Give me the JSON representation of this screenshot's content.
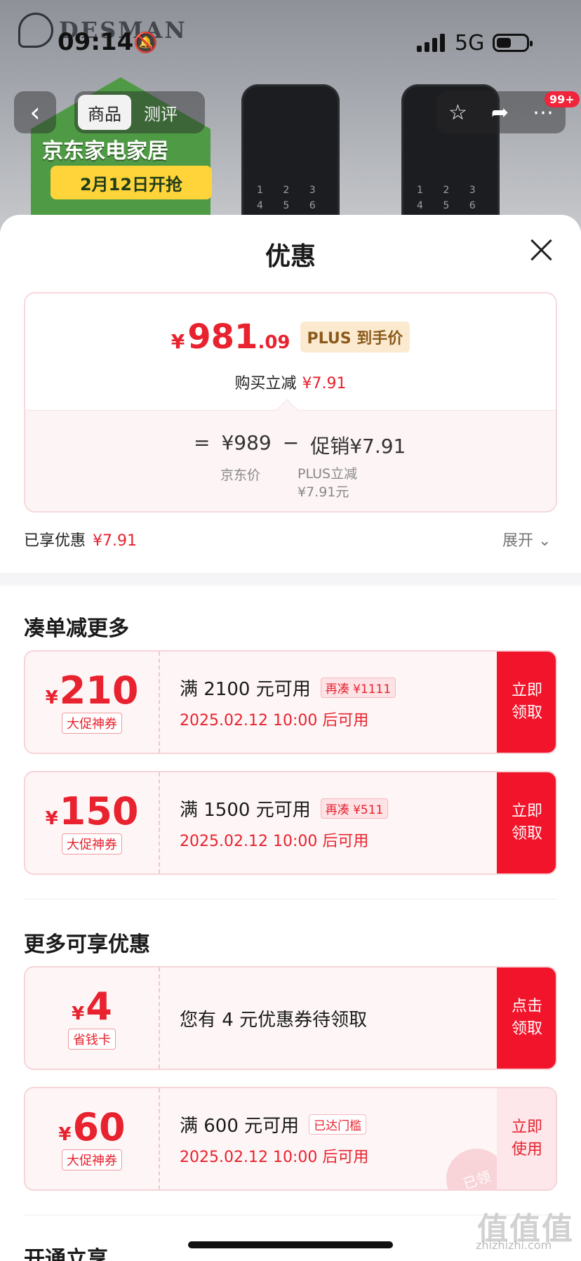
{
  "status_bar": {
    "time": "09:14",
    "network": "5G"
  },
  "background": {
    "brand": "DESMAN",
    "nav_tabs": [
      "商品",
      "测评"
    ],
    "cart_badge": "99+",
    "banner_title": "京东家电家居",
    "banner_date": "2月12日开抢"
  },
  "sheet": {
    "title": "优惠",
    "price": {
      "currency": "¥",
      "integer": "981",
      "decimal": ".09",
      "tag": "PLUS 到手价",
      "instant_label": "购买立减",
      "instant_value": "¥7.91",
      "eq": "=",
      "jd_price": "¥989",
      "minus": "−",
      "promo": "促销¥7.91",
      "jd_price_label": "京东价",
      "plus_label_1": "PLUS立减",
      "plus_label_2": "¥7.91元"
    },
    "enjoyed_label": "已享优惠",
    "enjoyed_value": "¥7.91",
    "expand_label": "展开",
    "section1_title": "凑单减更多",
    "section2_title": "更多可享优惠",
    "section3_title": "开通立享",
    "coupons": [
      {
        "currency": "¥",
        "amount": "210",
        "type": "大促神券",
        "line1": "满 2100 元可用",
        "tag": "再凑 ¥1111",
        "line2": "2025.02.12 10:00 后可用",
        "button": "立即领取"
      },
      {
        "currency": "¥",
        "amount": "150",
        "type": "大促神券",
        "line1": "满 1500 元可用",
        "tag": "再凑 ¥511",
        "line2": "2025.02.12 10:00 后可用",
        "button": "立即领取"
      },
      {
        "currency": "¥",
        "amount": "4",
        "type": "省钱卡",
        "line1": "您有 4 元优惠券待领取",
        "button": "点击领取"
      },
      {
        "currency": "¥",
        "amount": "60",
        "type": "大促神券",
        "line1": "满 600 元可用",
        "tag": "已达门槛",
        "line2": "2025.02.12 10:00 后可用",
        "button": "立即使用",
        "stamp": "已领"
      }
    ]
  },
  "watermark": {
    "main": "值值值",
    "sub": "zhizhizhi.com"
  },
  "colors": {
    "accent_red": "#e8222e",
    "button_red": "#f2142b",
    "plus_gold": "#8b5a1a"
  }
}
